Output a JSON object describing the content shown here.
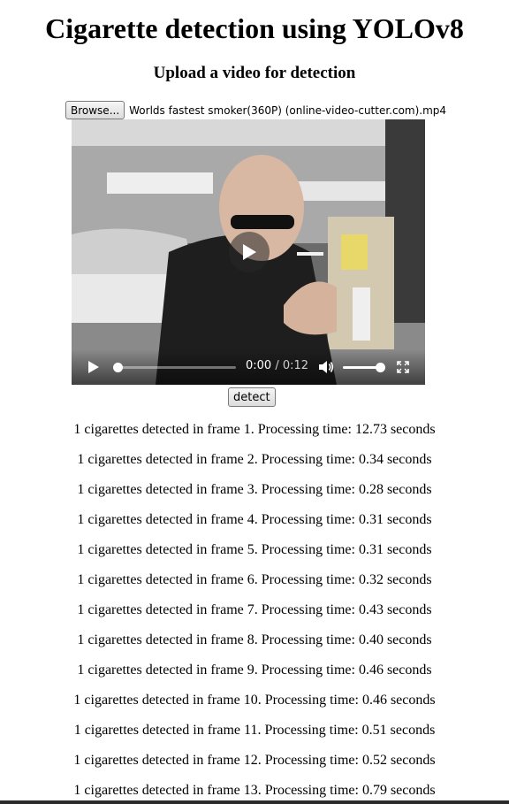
{
  "page": {
    "title": "Cigarette detection using YOLOv8",
    "subtitle": "Upload a video for detection"
  },
  "upload": {
    "browse_label": "Browse...",
    "file_name": "Worlds fastest smoker(360P) (online-video-cutter.com).mp4"
  },
  "video": {
    "current_time": "0:00",
    "total_time": " / 0:12",
    "progress_fraction": 0.0,
    "volume_fraction": 1.0,
    "icons": {
      "play": "play-icon",
      "big_play": "play-overlay-icon",
      "volume": "volume-icon",
      "fullscreen": "fullscreen-icon"
    }
  },
  "actions": {
    "detect_label": "detect"
  },
  "results": [
    "1 cigarettes detected in frame 1. Processing time: 12.73 seconds",
    "1 cigarettes detected in frame 2. Processing time: 0.34 seconds",
    "1 cigarettes detected in frame 3. Processing time: 0.28 seconds",
    "1 cigarettes detected in frame 4. Processing time: 0.31 seconds",
    "1 cigarettes detected in frame 5. Processing time: 0.31 seconds",
    "1 cigarettes detected in frame 6. Processing time: 0.32 seconds",
    "1 cigarettes detected in frame 7. Processing time: 0.43 seconds",
    "1 cigarettes detected in frame 8. Processing time: 0.40 seconds",
    "1 cigarettes detected in frame 9. Processing time: 0.46 seconds",
    "1 cigarettes detected in frame 10. Processing time: 0.46 seconds",
    "1 cigarettes detected in frame 11. Processing time: 0.51 seconds",
    "1 cigarettes detected in frame 12. Processing time: 0.52 seconds",
    "1 cigarettes detected in frame 13. Processing time: 0.79 seconds"
  ]
}
